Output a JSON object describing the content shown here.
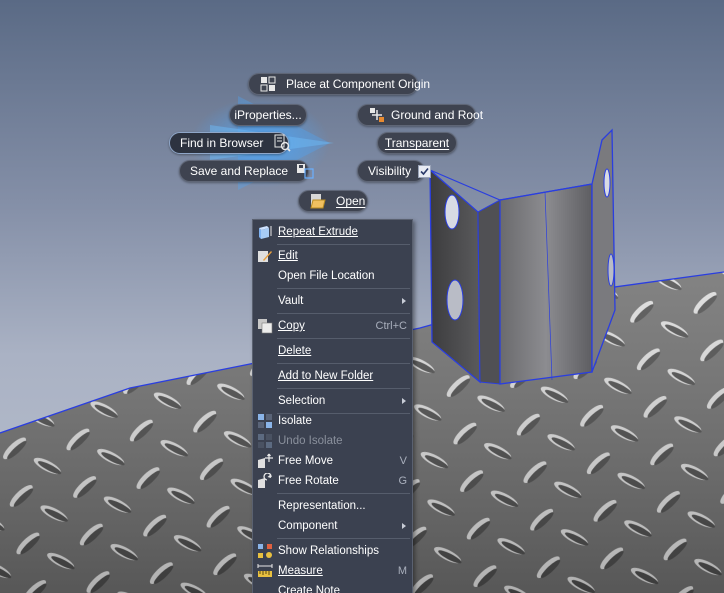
{
  "marking_menu": {
    "place_at_component_origin": "Place at Component Origin",
    "iproperties": "iProperties...",
    "ground_and_root": "Ground and Root",
    "find_in_browser": "Find in Browser",
    "transparent": "Transparent",
    "save_and_replace": "Save and Replace",
    "visibility": "Visibility",
    "visibility_checked": true,
    "open": "Open"
  },
  "context_menu": {
    "items": [
      {
        "label": "Repeat Extrude",
        "shortcut": "",
        "icon": "extrude-icon"
      },
      {
        "label": "Edit",
        "shortcut": "",
        "icon": "edit-icon"
      },
      {
        "label": "Open File Location",
        "shortcut": "",
        "icon": ""
      },
      {
        "label": "Vault",
        "shortcut": "",
        "icon": "",
        "submenu": true
      },
      {
        "label": "Copy",
        "shortcut": "Ctrl+C",
        "icon": "copy-icon"
      },
      {
        "label": "Delete",
        "shortcut": "",
        "icon": ""
      },
      {
        "label": "Add to New Folder",
        "shortcut": "",
        "icon": ""
      },
      {
        "label": "Selection",
        "shortcut": "",
        "icon": "",
        "submenu": true
      },
      {
        "label": "Isolate",
        "shortcut": "",
        "icon": "isolate-icon"
      },
      {
        "label": "Undo Isolate",
        "shortcut": "",
        "icon": "undo-isolate-icon",
        "disabled": true
      },
      {
        "label": "Free Move",
        "shortcut": "V",
        "icon": "free-move-icon"
      },
      {
        "label": "Free Rotate",
        "shortcut": "G",
        "icon": "free-rotate-icon"
      },
      {
        "label": "Representation...",
        "shortcut": "",
        "icon": ""
      },
      {
        "label": "Component",
        "shortcut": "",
        "icon": "",
        "submenu": true
      },
      {
        "label": "Show Relationships",
        "shortcut": "",
        "icon": "relationships-icon"
      },
      {
        "label": "Measure",
        "shortcut": "M",
        "icon": "measure-icon"
      },
      {
        "label": "Create Note",
        "shortcut": "",
        "icon": ""
      }
    ]
  },
  "colors": {
    "menu_bg": "#3b4150",
    "pill_bg": "#3e4350",
    "selection_edge": "#2a3ee0",
    "sky_top": "#5a6a85",
    "sky_bottom": "#b9c0ce"
  }
}
